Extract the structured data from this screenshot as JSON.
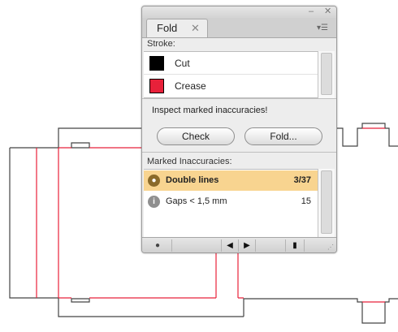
{
  "panel": {
    "tab_label": "Fold",
    "tab_close": "✕",
    "minimize_glyph": "–",
    "close_glyph": "✕",
    "menu_glyph": "▾☰"
  },
  "stroke": {
    "label": "Stroke:",
    "items": [
      {
        "name": "Cut",
        "color": "#000000"
      },
      {
        "name": "Crease",
        "color": "#e8213a"
      }
    ]
  },
  "inspect_message": "Inspect marked inaccuracies!",
  "buttons": {
    "check": "Check",
    "fold": "Fold..."
  },
  "inaccuracies": {
    "label": "Marked Inaccuracies:",
    "items": [
      {
        "name": "Double lines",
        "count": "3/37",
        "selected": true,
        "icon": "speech-bubble-icon",
        "icon_glyph": "💬"
      },
      {
        "name": "Gaps  < 1,5 mm",
        "count": "15",
        "selected": false,
        "icon": "info-bubble-icon",
        "icon_glyph": "i"
      }
    ]
  },
  "bottombar": {
    "comment_glyph": "💬",
    "prev_glyph": "◀",
    "next_glyph": "▶",
    "trash_glyph": "🗑"
  },
  "colors": {
    "cut_line": "#444444",
    "crease_line": "#e8213a",
    "selected_row": "#f8d490"
  }
}
